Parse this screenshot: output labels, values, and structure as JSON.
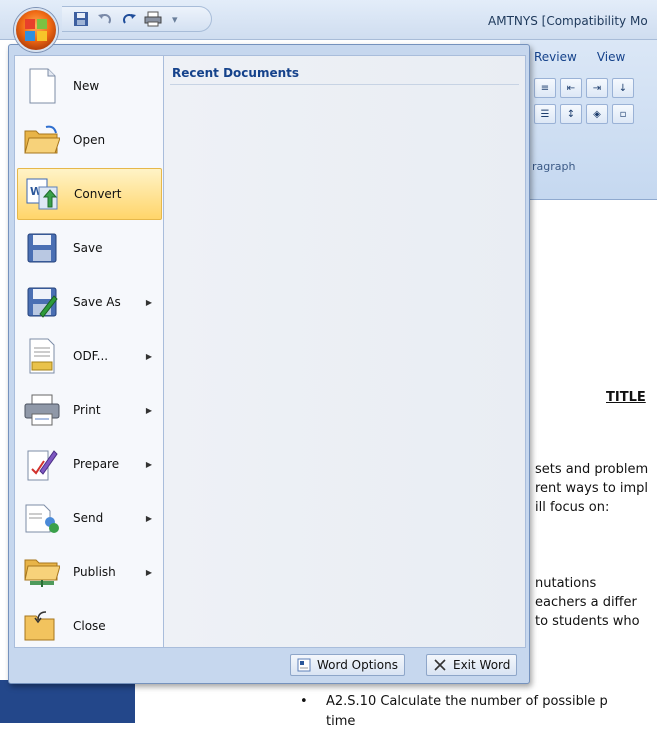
{
  "window": {
    "title": "AMTNYS [Compatibility Mo"
  },
  "ribbon": {
    "tabs": [
      "Review",
      "View"
    ],
    "group_label": "ragraph"
  },
  "office_menu": {
    "items": [
      {
        "label": "New",
        "icon": "new-document-icon",
        "has_submenu": false
      },
      {
        "label": "Open",
        "icon": "open-folder-icon",
        "has_submenu": false
      },
      {
        "label": "Convert",
        "icon": "convert-icon",
        "has_submenu": false
      },
      {
        "label": "Save",
        "icon": "save-disk-icon",
        "has_submenu": false
      },
      {
        "label": "Save As",
        "icon": "save-as-icon",
        "has_submenu": true
      },
      {
        "label": "ODF...",
        "icon": "odf-document-icon",
        "has_submenu": true
      },
      {
        "label": "Print",
        "icon": "printer-icon",
        "has_submenu": true
      },
      {
        "label": "Prepare",
        "icon": "prepare-pencil-icon",
        "has_submenu": true
      },
      {
        "label": "Send",
        "icon": "send-icon",
        "has_submenu": true
      },
      {
        "label": "Publish",
        "icon": "publish-folder-icon",
        "has_submenu": true
      },
      {
        "label": "Close",
        "icon": "close-folder-icon",
        "has_submenu": false
      }
    ],
    "selected_item": "Convert",
    "recent_documents_title": "Recent Documents",
    "word_options_label": "Word Options",
    "exit_word_label": "Exit Word"
  },
  "document": {
    "title_fragment": "TITLE",
    "lines": [
      "sets and problem",
      "rent ways to impl",
      "ill focus on:",
      "nutations",
      "eachers a differ",
      "to students who",
      "A2.S.10 Calculate the number of possible p",
      "time"
    ]
  },
  "colors": {
    "accent": "#15428b",
    "highlight": "#ffd56a",
    "menu_bg": "#c6d7ee"
  }
}
